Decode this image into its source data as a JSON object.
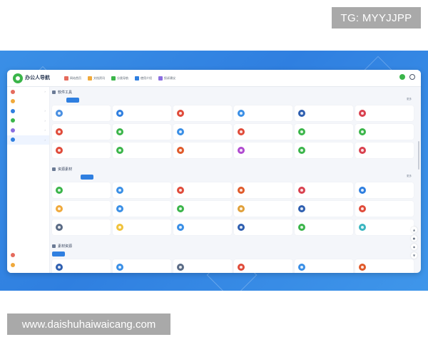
{
  "watermarks": {
    "top_right": "TG: MYYJJPP",
    "bottom_left": "www.daishuhaiwaicang.com"
  },
  "colors": {
    "banner_blue": "#2f7fe0",
    "accent": "#2f7fe0",
    "badge_gray": "#a9a9a9"
  },
  "app": {
    "logo_title": "办公人导航",
    "logo_subtitle": "",
    "nav": [
      {
        "label": "网站首页",
        "icon": "home-icon",
        "color": "#e56b5d"
      },
      {
        "label": "文档资讯",
        "icon": "document-icon",
        "color": "#f0a93b"
      },
      {
        "label": "分类导航",
        "icon": "grid-icon",
        "color": "#3bb54a"
      },
      {
        "label": "使用介绍",
        "icon": "info-icon",
        "color": "#2f7fe0"
      },
      {
        "label": "投诉建议",
        "icon": "message-icon",
        "color": "#8a6ee0"
      }
    ],
    "header_icons": [
      "avatar-icon",
      "search-icon"
    ]
  },
  "sidebar": {
    "items": [
      {
        "label": "",
        "icon": "chart-icon",
        "color": "#e56b5d",
        "sub": false,
        "active": false,
        "chevron": true
      },
      {
        "label": "",
        "icon": "bookmark-icon",
        "color": "#f0a93b",
        "sub": false,
        "active": false,
        "chevron": false
      },
      {
        "label": "",
        "icon": "briefcase-icon",
        "color": "#2f7fe0",
        "sub": false,
        "active": false,
        "chevron": true
      },
      {
        "label": "",
        "icon": "ai-icon",
        "color": "#3bb54a",
        "sub": false,
        "active": false,
        "chevron": true
      },
      {
        "label": "",
        "icon": "toolbox-icon",
        "color": "#8a6ee0",
        "sub": false,
        "active": false,
        "chevron": true
      },
      {
        "label": "",
        "icon": "folder-icon",
        "color": "#2f7fe0",
        "sub": false,
        "active": true,
        "chevron": true
      },
      {
        "label": "",
        "icon": "",
        "color": "",
        "sub": true,
        "active": false,
        "chevron": false
      },
      {
        "label": "",
        "icon": "",
        "color": "",
        "sub": true,
        "active": false,
        "chevron": false
      },
      {
        "label": "",
        "icon": "",
        "color": "",
        "sub": true,
        "active": false,
        "chevron": false
      },
      {
        "label": "",
        "icon": "",
        "color": "",
        "sub": true,
        "active": false,
        "chevron": false
      },
      {
        "label": "",
        "icon": "",
        "color": "",
        "sub": true,
        "active": false,
        "chevron": false
      },
      {
        "label": "",
        "icon": "",
        "color": "",
        "sub": true,
        "active": false,
        "chevron": false
      },
      {
        "label": "",
        "icon": "",
        "color": "",
        "sub": true,
        "active": false,
        "chevron": false
      },
      {
        "label": "",
        "icon": "",
        "color": "",
        "sub": true,
        "active": false,
        "chevron": false
      },
      {
        "label": "",
        "icon": "",
        "color": "",
        "sub": true,
        "active": false,
        "chevron": false
      },
      {
        "label": "",
        "icon": "",
        "color": "",
        "sub": true,
        "active": false,
        "chevron": false
      },
      {
        "label": "",
        "icon": "",
        "color": "",
        "sub": true,
        "active": false,
        "chevron": false
      },
      {
        "label": "",
        "icon": "gift-icon",
        "color": "#e56b5d",
        "sub": false,
        "active": false,
        "chevron": false
      },
      {
        "label": "",
        "icon": "star-icon",
        "color": "#f0a93b",
        "sub": false,
        "active": false,
        "chevron": false
      }
    ]
  },
  "sections": [
    {
      "title": "软件工具",
      "more": "更多",
      "tabs": [
        {
          "label": "",
          "active": false
        },
        {
          "label": "",
          "active": true
        },
        {
          "label": "",
          "active": false
        },
        {
          "label": "",
          "active": false
        },
        {
          "label": "",
          "active": false
        },
        {
          "label": "",
          "active": false
        },
        {
          "label": "",
          "active": false
        },
        {
          "label": "",
          "active": false
        },
        {
          "label": "",
          "active": false
        },
        {
          "label": "",
          "active": false
        },
        {
          "label": "",
          "active": false
        },
        {
          "label": "",
          "active": false
        },
        {
          "label": "",
          "active": false
        }
      ],
      "cards": [
        {
          "name": "",
          "desc": "",
          "color": "#4a90e2"
        },
        {
          "name": "",
          "desc": "",
          "color": "#2f7fe0"
        },
        {
          "name": "",
          "desc": "",
          "color": "#e04b3a"
        },
        {
          "name": "",
          "desc": "",
          "color": "#3a8fe6"
        },
        {
          "name": "",
          "desc": "",
          "color": "#2f5fb0"
        },
        {
          "name": "",
          "desc": "",
          "color": "#d9414f"
        },
        {
          "name": "",
          "desc": "",
          "color": "#e04b3a"
        },
        {
          "name": "",
          "desc": "",
          "color": "#3bb54a"
        },
        {
          "name": "",
          "desc": "",
          "color": "#3a8fe6"
        },
        {
          "name": "",
          "desc": "",
          "color": "#e04b3a"
        },
        {
          "name": "",
          "desc": "",
          "color": "#3bb54a"
        },
        {
          "name": "",
          "desc": "",
          "color": "#3bb54a"
        },
        {
          "name": "",
          "desc": "",
          "color": "#e04b3a"
        },
        {
          "name": "",
          "desc": "",
          "color": "#3bb54a"
        },
        {
          "name": "",
          "desc": "",
          "color": "#e05a2a"
        },
        {
          "name": "",
          "desc": "",
          "color": "#b04ad0"
        },
        {
          "name": "",
          "desc": "",
          "color": "#3bb54a"
        },
        {
          "name": "",
          "desc": "",
          "color": "#d9414f"
        }
      ]
    },
    {
      "title": "资源素材",
      "more": "更多",
      "tabs": [
        {
          "label": "",
          "active": false
        },
        {
          "label": "",
          "active": false
        },
        {
          "label": "",
          "active": true
        },
        {
          "label": "",
          "active": false
        },
        {
          "label": "",
          "active": false
        },
        {
          "label": "",
          "active": false
        },
        {
          "label": "",
          "active": false
        },
        {
          "label": "",
          "active": false
        },
        {
          "label": "",
          "active": false
        },
        {
          "label": "",
          "active": false
        },
        {
          "label": "",
          "active": false
        },
        {
          "label": "",
          "active": false
        },
        {
          "label": "",
          "active": false
        },
        {
          "label": "",
          "active": false
        }
      ],
      "cards": [
        {
          "name": "",
          "desc": "",
          "color": "#3bb54a"
        },
        {
          "name": "",
          "desc": "",
          "color": "#3a8fe6"
        },
        {
          "name": "",
          "desc": "",
          "color": "#e04b3a"
        },
        {
          "name": "",
          "desc": "",
          "color": "#e05a2a"
        },
        {
          "name": "",
          "desc": "",
          "color": "#d9414f"
        },
        {
          "name": "",
          "desc": "",
          "color": "#2f7fe0"
        },
        {
          "name": "",
          "desc": "",
          "color": "#f0a93b"
        },
        {
          "name": "",
          "desc": "",
          "color": "#3a8fe6"
        },
        {
          "name": "",
          "desc": "",
          "color": "#3bb54a"
        },
        {
          "name": "",
          "desc": "",
          "color": "#e0a03a"
        },
        {
          "name": "",
          "desc": "",
          "color": "#2f5fb0"
        },
        {
          "name": "",
          "desc": "",
          "color": "#e04b3a"
        },
        {
          "name": "",
          "desc": "",
          "color": "#5a6b85"
        },
        {
          "name": "",
          "desc": "",
          "color": "#f0c23b"
        },
        {
          "name": "",
          "desc": "",
          "color": "#3a8fe6"
        },
        {
          "name": "",
          "desc": "",
          "color": "#2f5fb0"
        },
        {
          "name": "",
          "desc": "",
          "color": "#3bb54a"
        },
        {
          "name": "",
          "desc": "",
          "color": "#3ab5c0"
        }
      ]
    },
    {
      "title": "素材资源",
      "more": "",
      "tabs": [
        {
          "label": "",
          "active": true
        },
        {
          "label": "",
          "active": false
        },
        {
          "label": "",
          "active": false
        },
        {
          "label": "",
          "active": false
        },
        {
          "label": "",
          "active": false
        },
        {
          "label": "",
          "active": false
        },
        {
          "label": "",
          "active": false
        },
        {
          "label": "",
          "active": false
        },
        {
          "label": "",
          "active": false
        },
        {
          "label": "",
          "active": false
        },
        {
          "label": "",
          "active": false
        },
        {
          "label": "",
          "active": false
        },
        {
          "label": "",
          "active": false
        },
        {
          "label": "",
          "active": false
        }
      ],
      "cards": [
        {
          "name": "",
          "desc": "",
          "color": "#2f5fb0"
        },
        {
          "name": "",
          "desc": "",
          "color": "#3a8fe6"
        },
        {
          "name": "",
          "desc": "",
          "color": "#5a6b85"
        },
        {
          "name": "",
          "desc": "",
          "color": "#e04b3a"
        },
        {
          "name": "",
          "desc": "",
          "color": "#3a8fe6"
        },
        {
          "name": "",
          "desc": "",
          "color": "#e05a2a"
        }
      ]
    }
  ],
  "float_tools": [
    "arrow-up-icon",
    "comment-icon",
    "share-icon",
    "arrow-down-icon"
  ]
}
